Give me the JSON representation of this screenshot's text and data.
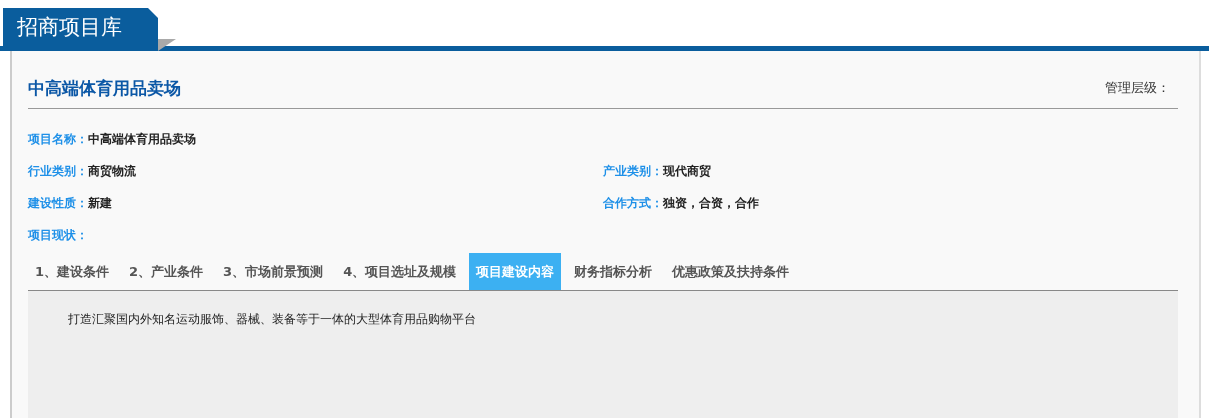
{
  "header": {
    "title": "招商项目库"
  },
  "project": {
    "title": "中高端体育用品卖场",
    "management_level_label": "管理层级："
  },
  "fields": [
    [
      {
        "label": "项目名称：",
        "value": "中高端体育用品卖场"
      }
    ],
    [
      {
        "label": "行业类别：",
        "value": "商贸物流"
      },
      {
        "label": "产业类别：",
        "value": "现代商贸"
      }
    ],
    [
      {
        "label": "建设性质：",
        "value": "新建"
      },
      {
        "label": "合作方式：",
        "value": "独资，合资，合作"
      }
    ],
    [
      {
        "label": "项目现状："
      }
    ]
  ],
  "tabs": [
    {
      "label": "1、建设条件",
      "selected": false
    },
    {
      "label": "2、产业条件",
      "selected": false
    },
    {
      "label": "3、市场前景预测",
      "selected": false
    },
    {
      "label": "4、项目选址及规模",
      "selected": false
    },
    {
      "label": "项目建设内容",
      "selected": true
    },
    {
      "label": "财务指标分析",
      "selected": false
    },
    {
      "label": "优惠政策及扶持条件",
      "selected": false
    }
  ],
  "content": {
    "text": "打造汇聚国内外知名运动服饰、器械、装备等于一体的大型体育用品购物平台"
  }
}
